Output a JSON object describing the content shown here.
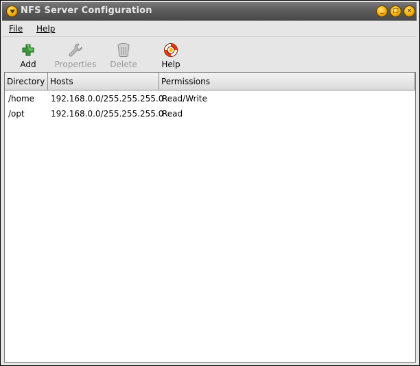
{
  "window": {
    "title": "NFS Server Configuration"
  },
  "menubar": {
    "items": [
      {
        "label": "File"
      },
      {
        "label": "Help"
      }
    ]
  },
  "toolbar": {
    "add_label": "Add",
    "properties_label": "Properties",
    "delete_label": "Delete",
    "help_label": "Help"
  },
  "table": {
    "columns": [
      "Directory",
      "Hosts",
      "Permissions"
    ],
    "rows": [
      {
        "directory": "/home",
        "hosts": "192.168.0.0/255.255.255.0",
        "permissions": "Read/Write"
      },
      {
        "directory": "/opt",
        "hosts": "192.168.0.0/255.255.255.0",
        "permissions": "Read"
      }
    ]
  }
}
